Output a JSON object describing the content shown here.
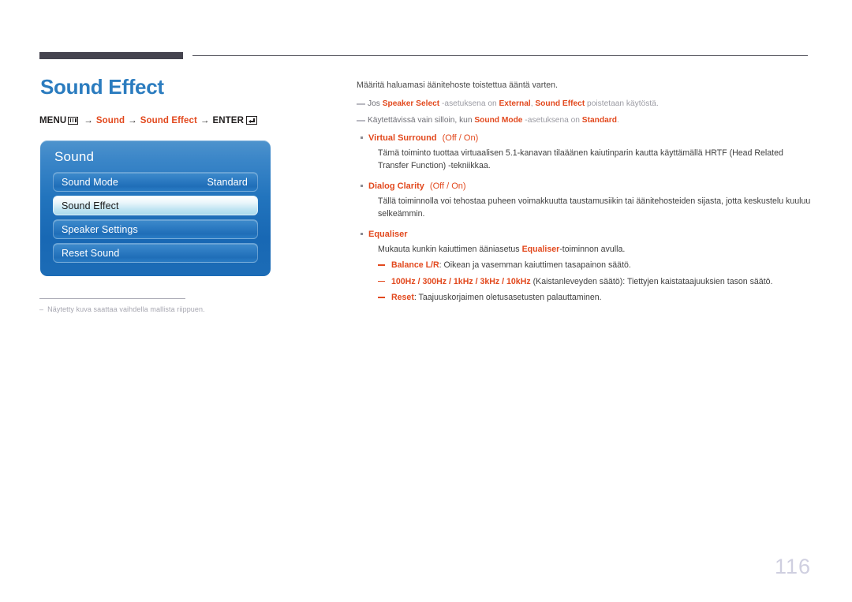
{
  "header": {
    "dark_bar": "",
    "rule": ""
  },
  "left": {
    "title": "Sound Effect",
    "menu_path": {
      "menu_label": "MENU",
      "menu_icon": "menu-bars-icon",
      "arrow": "→",
      "step1": "Sound",
      "step2": "Sound Effect",
      "enter_label": "ENTER",
      "enter_icon": "enter-return-icon"
    },
    "osd": {
      "title": "Sound",
      "rows": [
        {
          "label": "Sound Mode",
          "value": "Standard",
          "selected": false
        },
        {
          "label": "Sound Effect",
          "value": "",
          "selected": true
        },
        {
          "label": "Speaker Settings",
          "value": "",
          "selected": false
        },
        {
          "label": "Reset Sound",
          "value": "",
          "selected": false
        }
      ]
    },
    "footnote": {
      "dash": "–",
      "text": "Näytetty kuva saattaa vaihdella mallista riippuen."
    }
  },
  "right": {
    "lead": "Määritä haluamasi äänitehoste toistettua ääntä varten.",
    "notes": [
      {
        "p1": "Jos ",
        "b1": "Speaker Select",
        "p2": " -asetuksena on ",
        "b2": "External",
        "p3": ", ",
        "b3": "Sound Effect",
        "p4": " poistetaan käytöstä."
      },
      {
        "p1": "Käytettävissä vain silloin, kun ",
        "b1": "Sound Mode",
        "p2": " -asetuksena on ",
        "b2": "Standard",
        "p3": ".",
        "b3": "",
        "p4": ""
      }
    ],
    "bullets": [
      {
        "name": "Virtual Surround",
        "options": "(Off / On)",
        "body_p1": "Tämä toiminto tuottaa virtuaalisen 5.1-kanavan tilaäänen kaiutinparin kautta käyttämällä HRTF (Head Related Transfer Function) -tekniikkaa.",
        "body_b": "",
        "body_p2": ""
      },
      {
        "name": "Dialog Clarity",
        "options": "(Off / On)",
        "body_p1": "Tällä toiminnolla voi tehostaa puheen voimakkuutta taustamusiikin tai äänitehosteiden sijasta, jotta keskustelu kuuluu selkeämmin.",
        "body_b": "",
        "body_p2": ""
      },
      {
        "name": "Equaliser",
        "options": "",
        "body_p1": "Mukauta kunkin kaiuttimen ääniasetus ",
        "body_b": "Equaliser",
        "body_p2": "-toiminnon avulla."
      }
    ],
    "subitems": [
      {
        "term": "Balance L/R",
        "rest": ": Oikean ja vasemman kaiuttimen tasapainon säätö."
      },
      {
        "term": "100Hz / 300Hz / 1kHz / 3kHz / 10kHz",
        "rest": " (Kaistanleveyden säätö): Tiettyjen kaistataajuuksien tason säätö."
      },
      {
        "term": "Reset",
        "rest": ": Taajuuskorjaimen oletusasetusten palauttaminen."
      }
    ]
  },
  "page_number": "116",
  "colors": {
    "title_blue": "#2b7cbf",
    "accent_orange": "#e2491e",
    "header_bar": "#45444f",
    "osd_blue": "#1f6eb8",
    "page_number_gray": "#cfcfe0"
  }
}
